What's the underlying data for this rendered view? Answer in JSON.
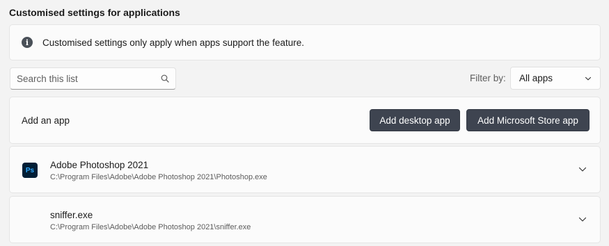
{
  "section": {
    "title": "Customised settings for applications"
  },
  "info": {
    "icon": "info-icon",
    "glyph": "i",
    "text": "Customised settings only apply when apps support the feature."
  },
  "search": {
    "placeholder": "Search this list",
    "value": ""
  },
  "filter": {
    "label": "Filter by:",
    "selected": "All apps"
  },
  "add_app": {
    "label": "Add an app",
    "desktop_button": "Add desktop app",
    "store_button": "Add Microsoft Store app"
  },
  "apps": [
    {
      "name": "Adobe Photoshop 2021",
      "path": "C:\\Program Files\\Adobe\\Adobe Photoshop 2021\\Photoshop.exe",
      "icon": "photoshop-icon",
      "icon_text": "Ps"
    },
    {
      "name": "sniffer.exe",
      "path": "C:\\Program Files\\Adobe\\Adobe Photoshop 2021\\sniffer.exe",
      "icon": "none"
    }
  ],
  "colors": {
    "button_bg": "#3e4450",
    "page_bg": "#f3f3f3",
    "card_bg": "#fbfbfb",
    "ps_bg": "#001e36",
    "ps_text": "#31a8ff"
  }
}
